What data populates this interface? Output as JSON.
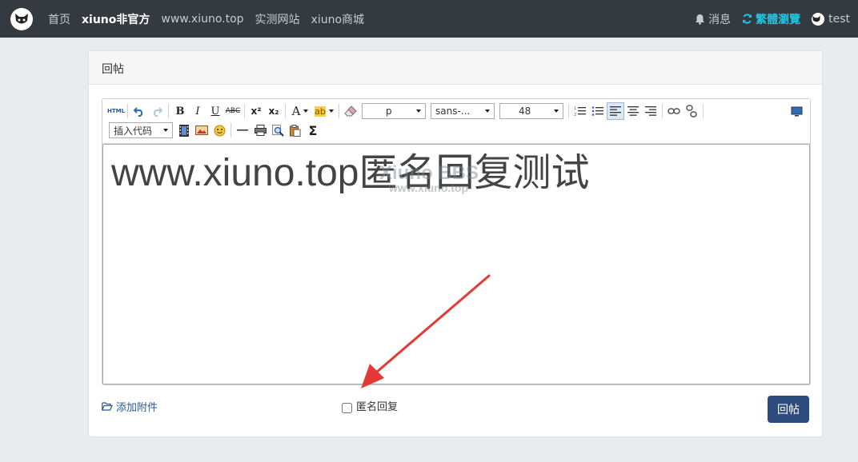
{
  "nav": {
    "links": [
      {
        "label": "首页",
        "active": false
      },
      {
        "label": "xiuno非官方",
        "active": true
      },
      {
        "label": "www.xiuno.top",
        "active": false
      },
      {
        "label": "实测网站",
        "active": false
      },
      {
        "label": "xiuno商城",
        "active": false
      }
    ],
    "messages_label": "消息",
    "traditional_label": "繁體瀏覽",
    "user_label": "test"
  },
  "card": {
    "title": "回帖"
  },
  "toolbar": {
    "html_label": "HTML",
    "bold_label": "B",
    "italic_label": "I",
    "underline_label": "U",
    "strike_label": "ABC",
    "font_color_label": "A",
    "bg_color_label": "ab",
    "paragraph_value": "p",
    "font_family_value": "sans-...",
    "font_size_value": "48",
    "insert_code_value": "插入代码",
    "sigma_label": "Σ",
    "superscript_label": "x²",
    "subscript_label": "x₂"
  },
  "editor": {
    "content": "www.xiuno.top匿名回复测试",
    "watermark_line1": "Xiuno BBS",
    "watermark_line2": "www.xiuno.top"
  },
  "footer": {
    "attach_label": "添加附件",
    "anonymous_label": "匿名回复",
    "anonymous_checked": false,
    "submit_label": "回帖"
  },
  "colors": {
    "navbar_bg": "#343a40",
    "accent_cyan": "#1ec6e6",
    "submit_bg": "#2c4c7e",
    "arrow_red": "#e53935"
  }
}
